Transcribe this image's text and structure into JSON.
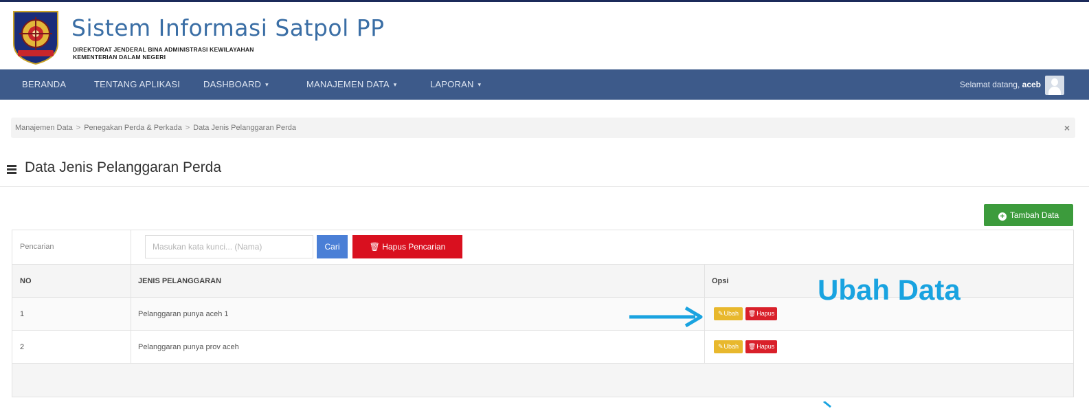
{
  "app": {
    "title": "Sistem Informasi Satpol PP",
    "subtitle_line1": "DIREKTORAT JENDERAL BINA ADMINISTRASI KEWILAYAHAN",
    "subtitle_line2": "KEMENTERIAN DALAM NEGERI",
    "logo_icon": "satpol-pp-emblem"
  },
  "nav": {
    "items": [
      {
        "label": "BERANDA"
      },
      {
        "label": "TENTANG APLIKASI"
      },
      {
        "label": "DASHBOARD",
        "dropdown": true
      },
      {
        "label": "MANAJEMEN DATA",
        "dropdown": true
      },
      {
        "label": "LAPORAN",
        "dropdown": true
      }
    ],
    "caret": "▾",
    "welcome_prefix": "Selamat datang,",
    "username": "aceb",
    "avatar_icon": "user-avatar-icon"
  },
  "breadcrumb": {
    "items": [
      "Manajemen Data",
      "Penegakan Perda & Perkada",
      "Data Jenis Pelanggaran Perda"
    ],
    "separator": ">",
    "close": "×"
  },
  "page": {
    "title": "Data Jenis Pelanggaran Perda",
    "add_button": "Tambah Data",
    "add_icon": "plus-circle-icon"
  },
  "search": {
    "label": "Pencarian",
    "placeholder": "Masukan kata kunci... (Nama)",
    "search_button": "Cari",
    "clear_button": "Hapus Pencarian",
    "clear_icon": "trash-icon"
  },
  "table": {
    "headers": {
      "no": "NO",
      "jenis": "JENIS PELANGGARAN",
      "opsi": "Opsi"
    },
    "rows": [
      {
        "no": "1",
        "jenis": "Pelanggaran punya aceh 1"
      },
      {
        "no": "2",
        "jenis": "Pelanggaran punya prov aceh"
      }
    ],
    "edit_label": "Ubah",
    "delete_label": "Hapus",
    "edit_icon": "pencil-icon",
    "delete_icon": "trash-icon"
  },
  "annotation": {
    "text": "Ubah Data",
    "color": "#19a3e0"
  },
  "colors": {
    "navbar": "#3d5a8a",
    "title": "#3a6ea5",
    "add_button": "#3c9b3c",
    "search_button": "#4a7fd6",
    "danger": "#d9101f",
    "edit": "#e8b82d"
  }
}
